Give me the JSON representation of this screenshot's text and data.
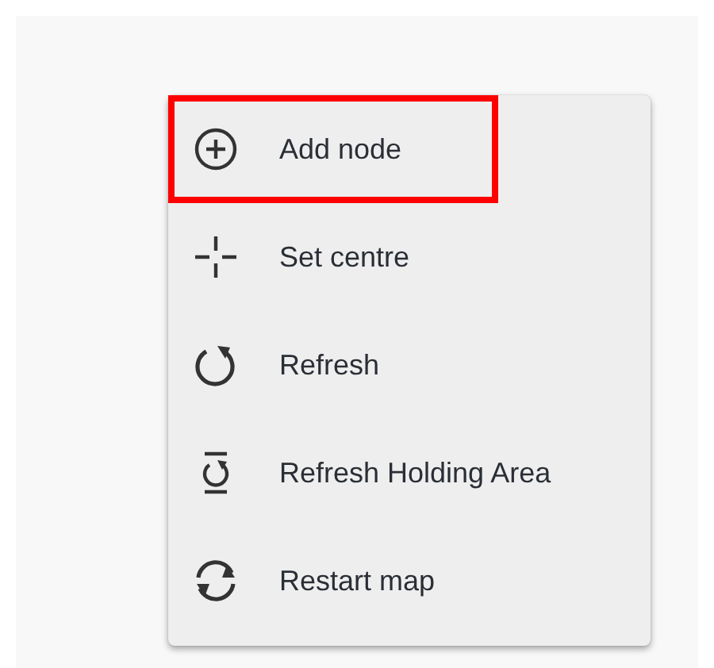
{
  "menu": {
    "items": [
      {
        "kind": "add",
        "label": "Add node",
        "highlighted": true
      },
      {
        "kind": "centre",
        "label": "Set centre",
        "highlighted": false
      },
      {
        "kind": "refresh",
        "label": "Refresh",
        "highlighted": false
      },
      {
        "kind": "holding",
        "label": "Refresh Holding Area",
        "highlighted": false
      },
      {
        "kind": "restart",
        "label": "Restart map",
        "highlighted": false
      }
    ]
  }
}
